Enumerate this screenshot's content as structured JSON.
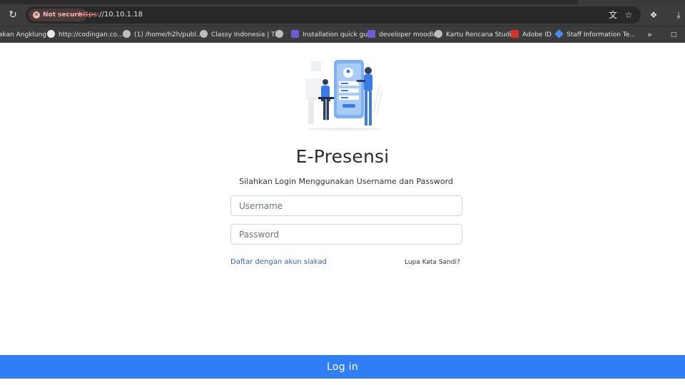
{
  "browser": {
    "security_chip": "Not secure",
    "url_scheme": "https",
    "url_rest": "://10.10.1.18",
    "icons": [
      "reload-icon",
      "translate-icon",
      "star-icon",
      "extensions-icon",
      "download-icon"
    ]
  },
  "bookmarks": {
    "items": [
      {
        "label": "akan Angklung",
        "icon": "none"
      },
      {
        "label": "http://codingan.co...",
        "icon": "codingan-icon"
      },
      {
        "label": "(1) /home/h2h/publ...",
        "icon": "globe-icon"
      },
      {
        "label": "Classy Indonesia | Ti...",
        "icon": "globe-icon"
      },
      {
        "label": "Installation quick gu...",
        "icon": "moodle-icon"
      },
      {
        "label": "developer moodle",
        "icon": "moodle-icon"
      },
      {
        "label": "Kartu Rencana Studi...",
        "icon": "globe-icon"
      },
      {
        "label": "Adobe ID",
        "icon": "adobe-icon"
      },
      {
        "label": "Staff Information Te...",
        "icon": "staff-icon"
      }
    ],
    "overflow": "»"
  },
  "login": {
    "title": "E-Presensi",
    "subtitle": "Silahkan Login Menggunakan Username dan Password",
    "username_placeholder": "Username",
    "password_placeholder": "Password",
    "register_link": "Daftar dengan akun siakad",
    "forgot_link": "Lupa Kata Sandi?",
    "submit_label": "Log in"
  },
  "colors": {
    "accent": "#2f7ef5",
    "link": "#3a64b3",
    "chrome": "#3c3c3c"
  }
}
